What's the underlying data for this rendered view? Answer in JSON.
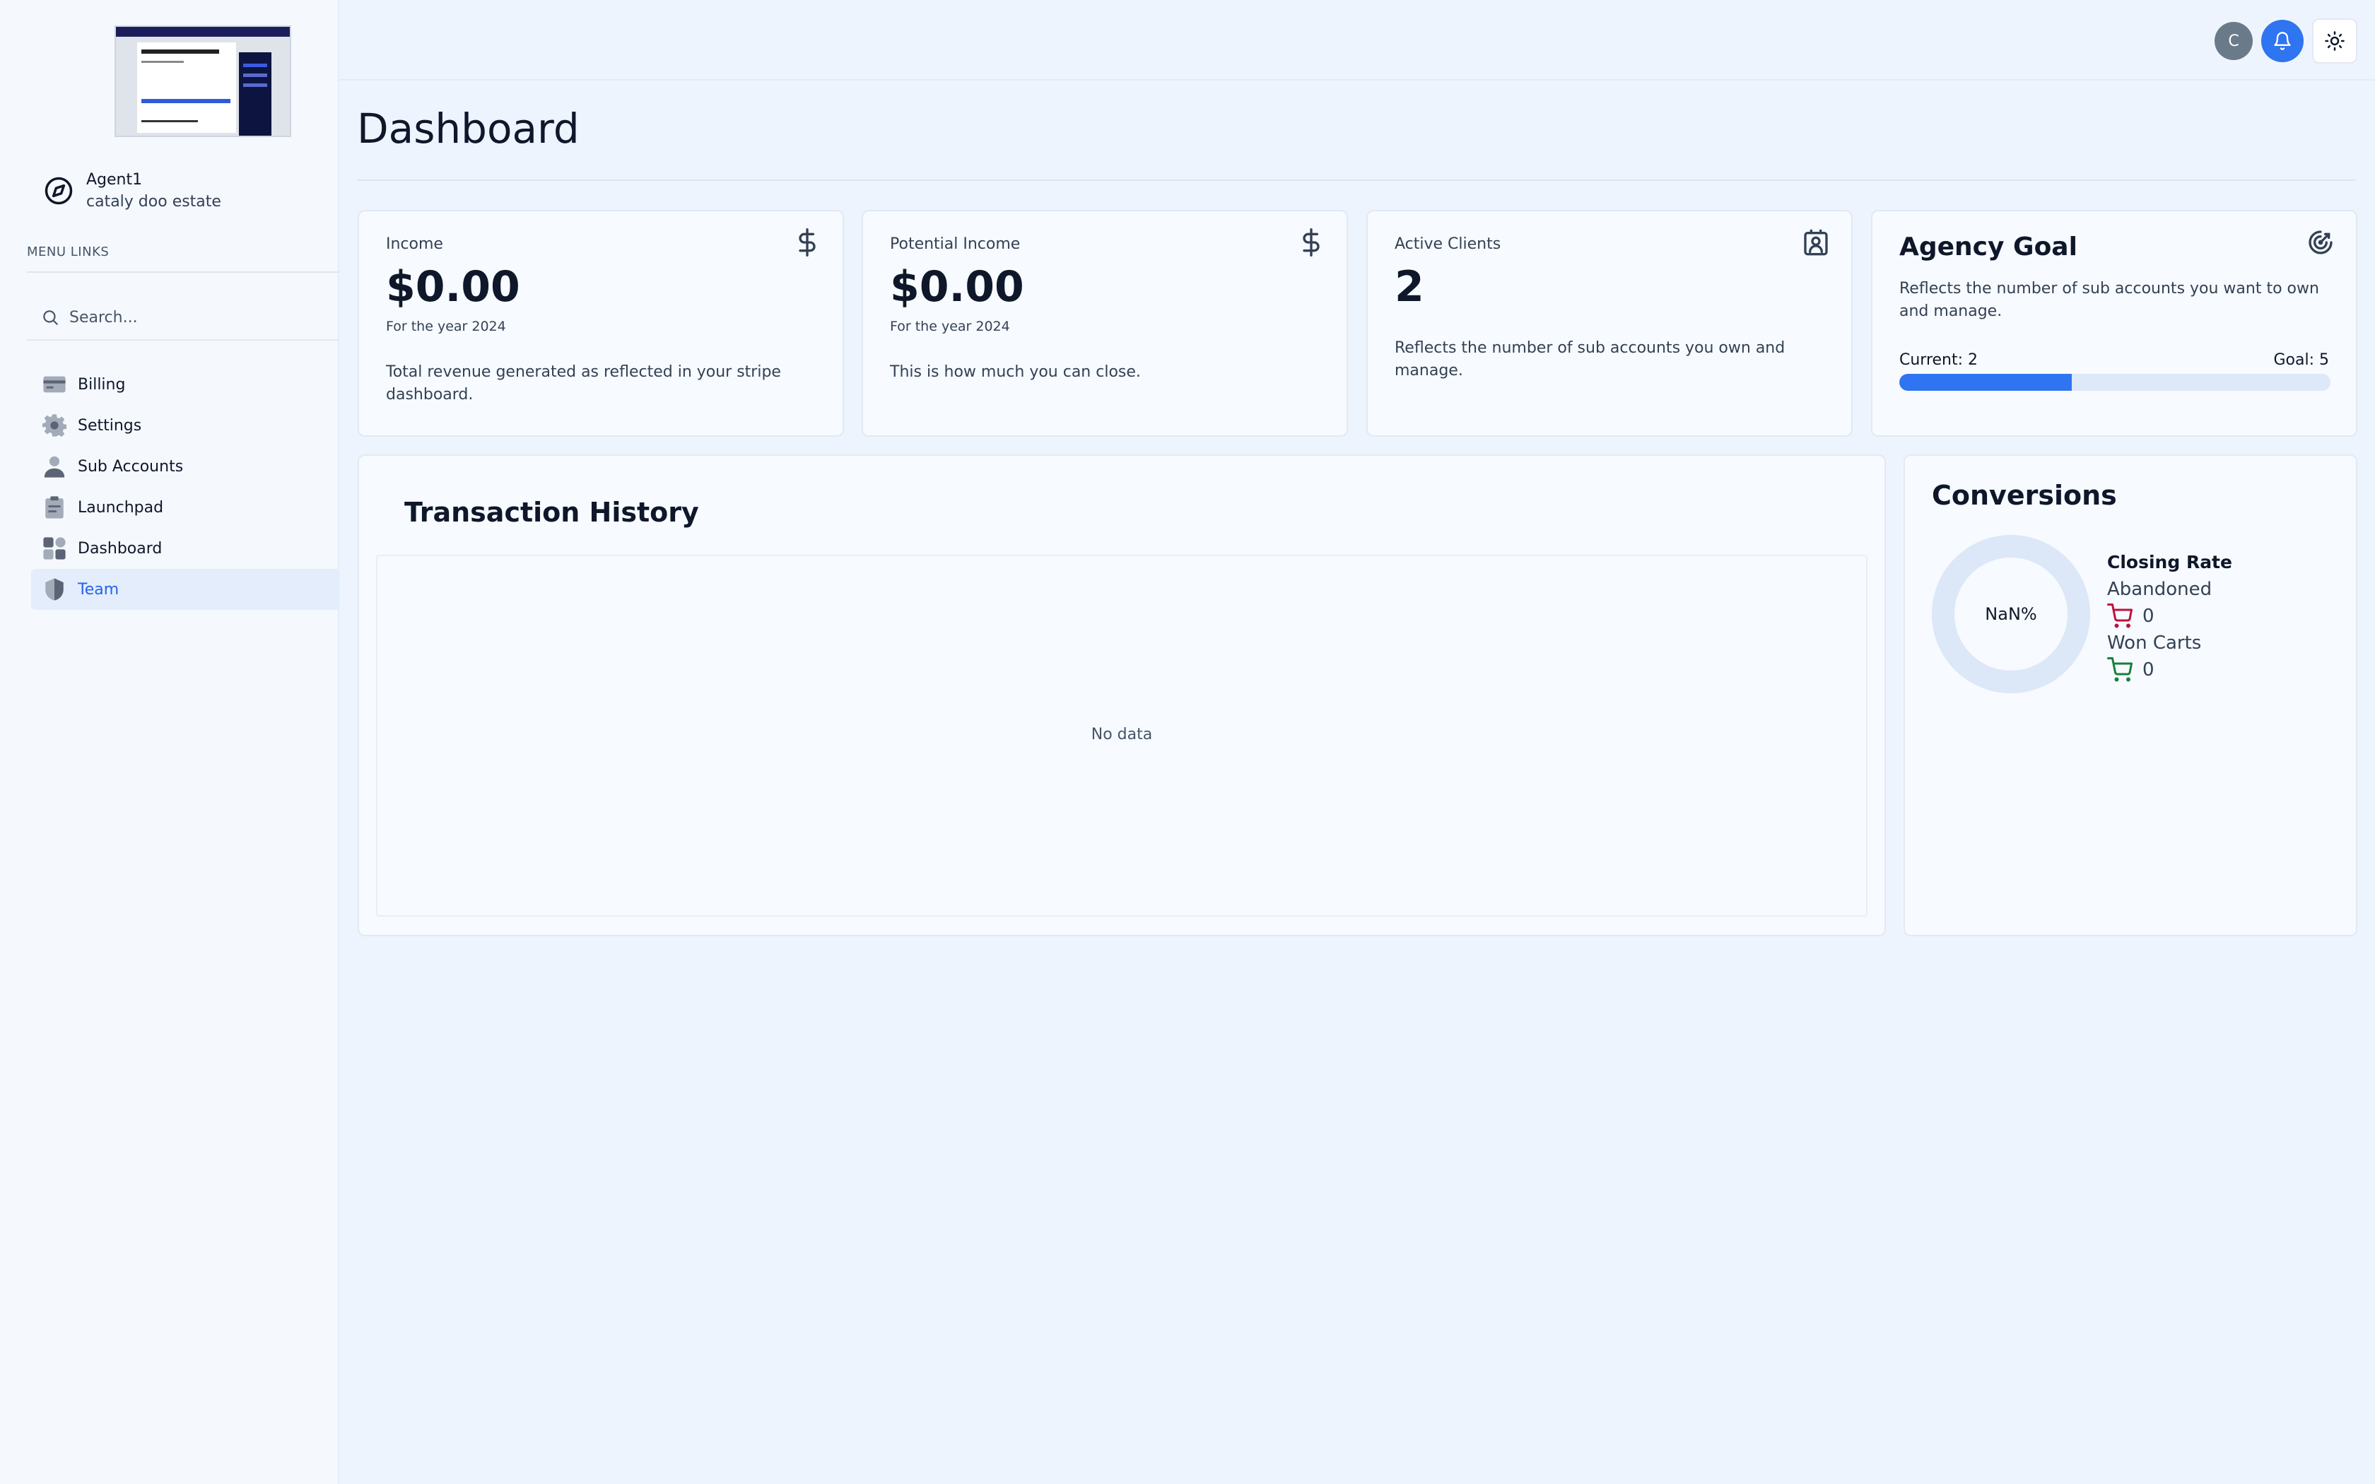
{
  "account": {
    "name": "Agent1",
    "subtitle": "cataly doo estate"
  },
  "sidebar": {
    "heading": "MENU LINKS",
    "search_placeholder": "Search...",
    "items": [
      {
        "label": "Billing",
        "icon": "credit-card-icon"
      },
      {
        "label": "Settings",
        "icon": "gear-icon"
      },
      {
        "label": "Sub Accounts",
        "icon": "person-icon"
      },
      {
        "label": "Launchpad",
        "icon": "clipboard-icon"
      },
      {
        "label": "Dashboard",
        "icon": "grid-icon"
      },
      {
        "label": "Team",
        "icon": "shield-icon",
        "active": true
      }
    ]
  },
  "topbar": {
    "avatar_letter": "C",
    "accent_color": "#2f74f0"
  },
  "main": {
    "title": "Dashboard",
    "stats": [
      {
        "label": "Income",
        "value": "$0.00",
        "sub": "For the year 2024",
        "desc": "Total revenue generated as reflected in your stripe dashboard.",
        "icon": "dollar-icon"
      },
      {
        "label": "Potential Income",
        "value": "$0.00",
        "sub": "For the year 2024",
        "desc": "This is how much you can close.",
        "icon": "dollar-icon"
      },
      {
        "label": "Active Clients",
        "value": "2",
        "desc": "Reflects the number of sub accounts you own and manage.",
        "icon": "contact-icon"
      }
    ],
    "goal": {
      "title": "Agency Goal",
      "desc": "Reflects the number of sub accounts you want to own and manage.",
      "current_label": "Current: 2",
      "goal_label": "Goal: 5",
      "progress": 0.4,
      "icon": "target-icon"
    },
    "transactions": {
      "title": "Transaction History",
      "empty": "No data"
    },
    "conversions": {
      "title": "Conversions",
      "rate": "NaN%",
      "heading": "Closing Rate",
      "abandoned_label": "Abandoned",
      "abandoned_value": "0",
      "abandoned_color": "#be123c",
      "won_label": "Won Carts",
      "won_value": "0",
      "won_color": "#15803d"
    }
  }
}
